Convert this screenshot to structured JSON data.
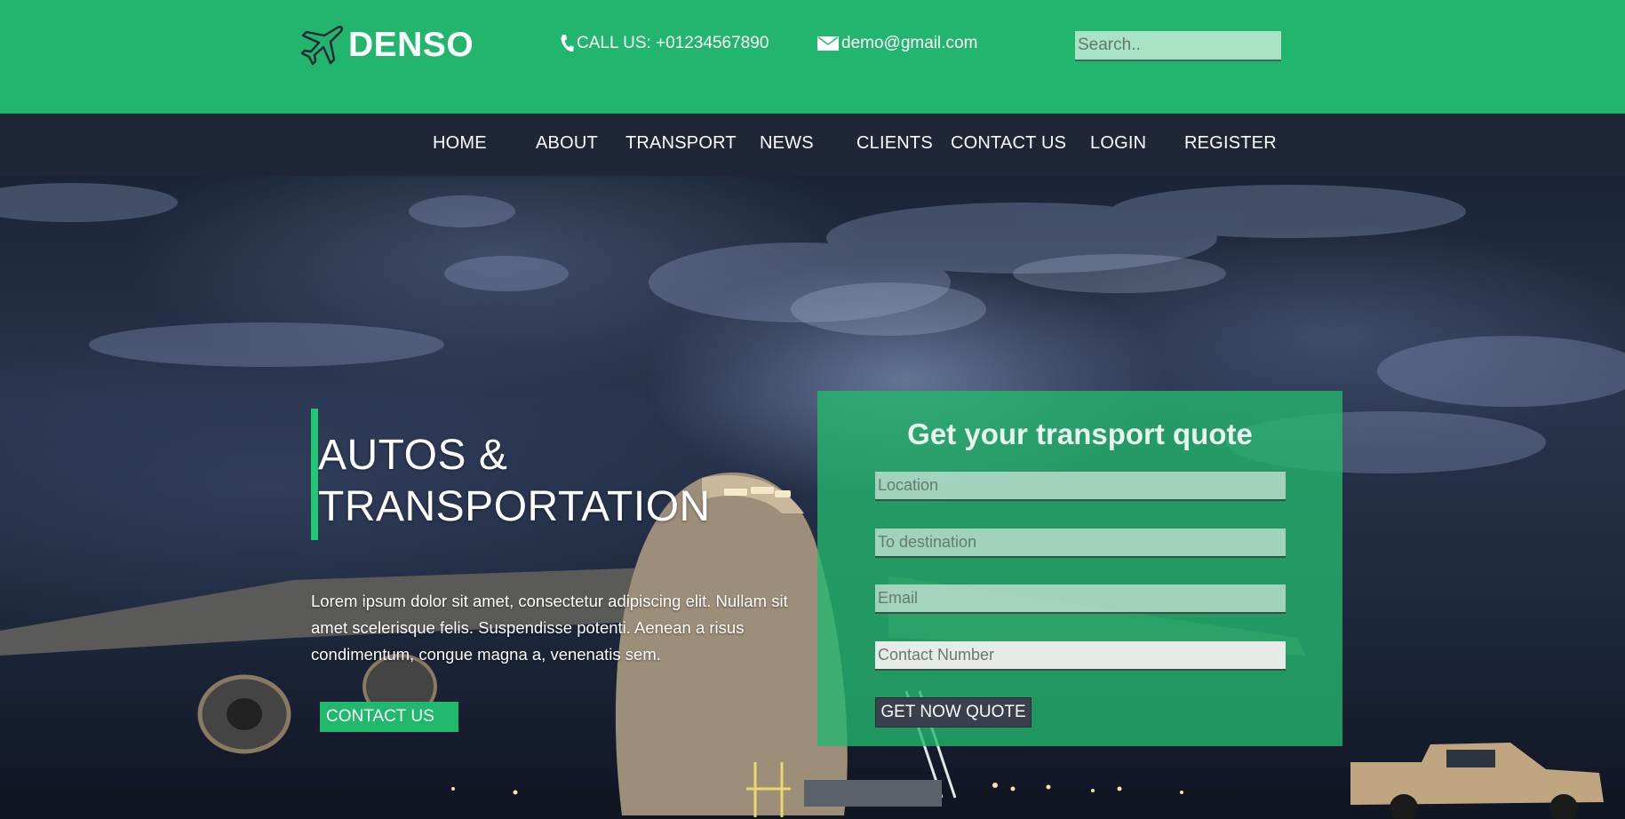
{
  "header": {
    "brand_name": "DENSO",
    "call_text": "CALL US: +01234567890",
    "email_text": "demo@gmail.com",
    "search_placeholder": "Search.."
  },
  "nav": {
    "items": [
      "HOME",
      "ABOUT",
      "TRANSPORT",
      "NEWS",
      "CLIENTS",
      "CONTACT US",
      "LOGIN",
      "REGISTER"
    ]
  },
  "hero": {
    "headline_line1": "AUTOS &",
    "headline_line2": "TRANSPORTATION",
    "body_text": "Lorem ipsum dolor sit amet, consectetur adipiscing elit. Nullam sit amet scelerisque felis. Suspendisse potenti. Aenean a risus condimentum, congue magna a, venenatis sem.",
    "contact_button": "CONTACT US"
  },
  "quote_form": {
    "title": "Get your transport quote",
    "location_placeholder": "Location",
    "destination_placeholder": "To destination",
    "email_placeholder": "Email",
    "contact_placeholder": "Contact Number",
    "submit_label": "GET NOW QUOTE"
  },
  "colors": {
    "brand_green": "#21b56e",
    "nav_dark": "#1f2638",
    "accent_green": "#22c774",
    "button_dark": "#3c3f4d"
  },
  "icons": {
    "logo": "airplane-outline-icon",
    "phone": "phone-icon",
    "mail": "envelope-icon"
  }
}
